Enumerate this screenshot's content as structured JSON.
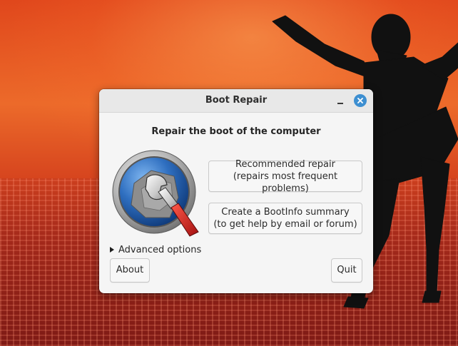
{
  "window": {
    "title": "Boot Repair"
  },
  "content": {
    "heading": "Repair the boot of the computer",
    "recommended_repair": {
      "line1": "Recommended repair",
      "line2": "(repairs most frequent problems)"
    },
    "bootinfo_summary": {
      "line1": "Create a BootInfo summary",
      "line2": "(to get help by email or forum)"
    },
    "advanced_options_label": "Advanced options",
    "about_label": "About",
    "quit_label": "Quit"
  },
  "icons": {
    "logo": "boot-repair-wrench-logo",
    "minimize": "minimize-icon",
    "close": "close-icon",
    "expander": "expander-arrow-icon"
  },
  "colors": {
    "close_button": "#3d8fd1",
    "dialog_bg": "#f5f5f5",
    "titlebar_bg": "#e8e8e8"
  }
}
